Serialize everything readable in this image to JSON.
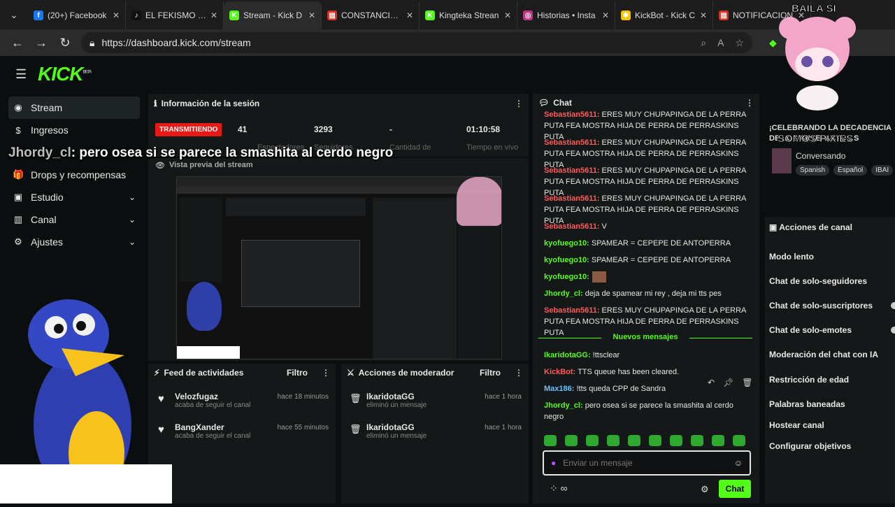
{
  "browser": {
    "tabs": [
      {
        "label": "(20+) Facebook",
        "icon_color": "#1877f2",
        "icon": "facebook-icon",
        "glyph": "f"
      },
      {
        "label": "EL FEKISMO (@",
        "icon_color": "#111111",
        "icon": "tiktok-icon",
        "glyph": "♪"
      },
      {
        "label": "Stream - Kick D",
        "icon_color": "#53fc18",
        "icon": "kick-icon",
        "glyph": "K"
      },
      {
        "label": "CONSTANCIA D",
        "icon_color": "#d93025",
        "icon": "pdf-icon",
        "glyph": "▤"
      },
      {
        "label": "Kingteka Strean",
        "icon_color": "#53fc18",
        "icon": "kick-icon",
        "glyph": "K"
      },
      {
        "label": "Historias • Insta",
        "icon_color": "#c13584",
        "icon": "instagram-icon",
        "glyph": "◎"
      },
      {
        "label": "KickBot - Kick C",
        "icon_color": "#f5c400",
        "icon": "kickbot-icon",
        "glyph": "✱"
      },
      {
        "label": "NOTIFICACION",
        "icon_color": "#d93025",
        "icon": "pdf-icon",
        "glyph": "▤"
      }
    ],
    "url": "https://dashboard.kick.com/stream"
  },
  "overlay": {
    "pink_text_top": "BAILA SI",
    "pink_text_bottom": "SOMOS PIXIES",
    "chat_user": "Jhordy_cl",
    "chat_text": ": pero osea si se parece la smashita al cerdo negro"
  },
  "logo": {
    "text": "KICK",
    "badge": "BETA"
  },
  "sidebar": {
    "items": [
      {
        "label": "Stream",
        "icon": "broadcast-icon",
        "glyph": "((·))",
        "active": true
      },
      {
        "label": "Ingresos",
        "icon": "money-icon",
        "glyph": "$"
      },
      {
        "label": "Drops y recompensas",
        "icon": "gift-icon",
        "glyph": "🎁"
      },
      {
        "label": "Estudio",
        "icon": "studio-icon",
        "glyph": "▣",
        "chevron": true
      },
      {
        "label": "Canal",
        "icon": "channel-icon",
        "glyph": "▥",
        "chevron": true
      },
      {
        "label": "Ajustes",
        "icon": "settings-icon",
        "glyph": "⚙",
        "chevron": true
      }
    ]
  },
  "session": {
    "title": "Información de la sesión",
    "live_badge": "TRANSMITIENDO",
    "viewers": "41",
    "viewers_label": "Espectadores",
    "followers": "3293",
    "followers_label": "Seguidores",
    "amount": "-",
    "amount_label": "Cantidad de",
    "time": "01:10:58",
    "time_label": "Tiempo en vivo",
    "preview_title": "Vista previa del stream"
  },
  "activity_feed": {
    "title": "Feed de actividades",
    "filter": "Filtro",
    "items": [
      {
        "user": "Velozfugaz",
        "action": "acaba de seguir el canal",
        "time": "hace 18 minutos"
      },
      {
        "user": "BangXander",
        "action": "acaba de seguir el canal",
        "time": "hace 55 minutos"
      }
    ]
  },
  "mod_actions": {
    "title": "Acciones de moderador",
    "filter": "Filtro",
    "items": [
      {
        "user": "IkaridotaGG",
        "action": "eliminó un mensaje",
        "time": "hace 1 hora"
      },
      {
        "user": "IkaridotaGG",
        "action": "eliminó un mensaje",
        "time": "hace 1 hora"
      }
    ]
  },
  "chat": {
    "title": "Chat",
    "messages": [
      {
        "user": "Sebastian5611:",
        "text": " ERES MUY CHUPAPINGA DE LA PERRA PUTA FEA MOSTRA HIJA DE PERRA DE PERRASKINS PUTA",
        "color": "red"
      },
      {
        "user": "Sebastian5611:",
        "text": " ERES MUY CHUPAPINGA DE LA PERRA PUTA FEA MOSTRA HIJA DE PERRA DE PERRASKINS PUTA",
        "color": "red"
      },
      {
        "user": "Sebastian5611:",
        "text": " ERES MUY CHUPAPINGA DE LA PERRA PUTA FEA MOSTRA HIJA DE PERRA DE PERRASKINS PUTA",
        "color": "red"
      },
      {
        "user": "Sebastian5611:",
        "text": " ERES MUY CHUPAPINGA DE LA PERRA PUTA FEA MOSTRA HIJA DE PERRA DE PERRASKINS PUTA",
        "color": "red"
      },
      {
        "user": "Sebastian5611:",
        "text": " V",
        "color": "red"
      },
      {
        "user": "kyofuego10:",
        "text": " SPAMEAR = CEPEPE DE ANTOPERRA",
        "color": "grn"
      },
      {
        "user": "kyofuego10:",
        "text": " SPAMEAR = CEPEPE DE ANTOPERRA",
        "color": "grn"
      },
      {
        "user": "kyofuego10:",
        "text": "",
        "color": "grn"
      },
      {
        "user": "Jhordy_cl:",
        "text": " deja de spamear mi rey , deja mi tts pes",
        "color": "grn"
      },
      {
        "user": "Sebastian5611:",
        "text": " ERES MUY CHUPAPINGA DE LA PERRA PUTA FEA MOSTRA HIJA DE PERRA DE PERRASKINS PUTA",
        "color": "red"
      }
    ],
    "new_messages_label": "Nuevos mensajes",
    "new_messages": [
      {
        "user": "IkaridotaGG:",
        "text": " !ttsclear",
        "color": "grn"
      },
      {
        "user": "KickBot:",
        "text": " TTS queue has been cleared.",
        "color": "red"
      },
      {
        "user": "Max186:",
        "text": " !tts queda CPP de Sandra",
        "color": "cyan"
      },
      {
        "user": "Jhordy_cl:",
        "text": " pero osea si se parece la smashita al cerdo negro",
        "color": "grn"
      }
    ],
    "input_placeholder": "Enviar un mensaje",
    "send_label": "Chat"
  },
  "right": {
    "stream_title": "¡CELEBRANDO LA DECADENCIA DE LOS ARTEFACTOS S",
    "category": "Conversando",
    "tags": [
      "Spanish",
      "Español",
      "IBAI"
    ],
    "channel_actions_title": "Acciones de canal",
    "actions": [
      "Modo lento",
      "Chat de solo-seguidores",
      "Chat de solo-suscriptores",
      "Chat de solo-emotes",
      "Moderación del chat con IA",
      "Restricción de edad",
      "Palabras baneadas",
      "Hostear canal",
      "Configurar objetivos"
    ]
  }
}
